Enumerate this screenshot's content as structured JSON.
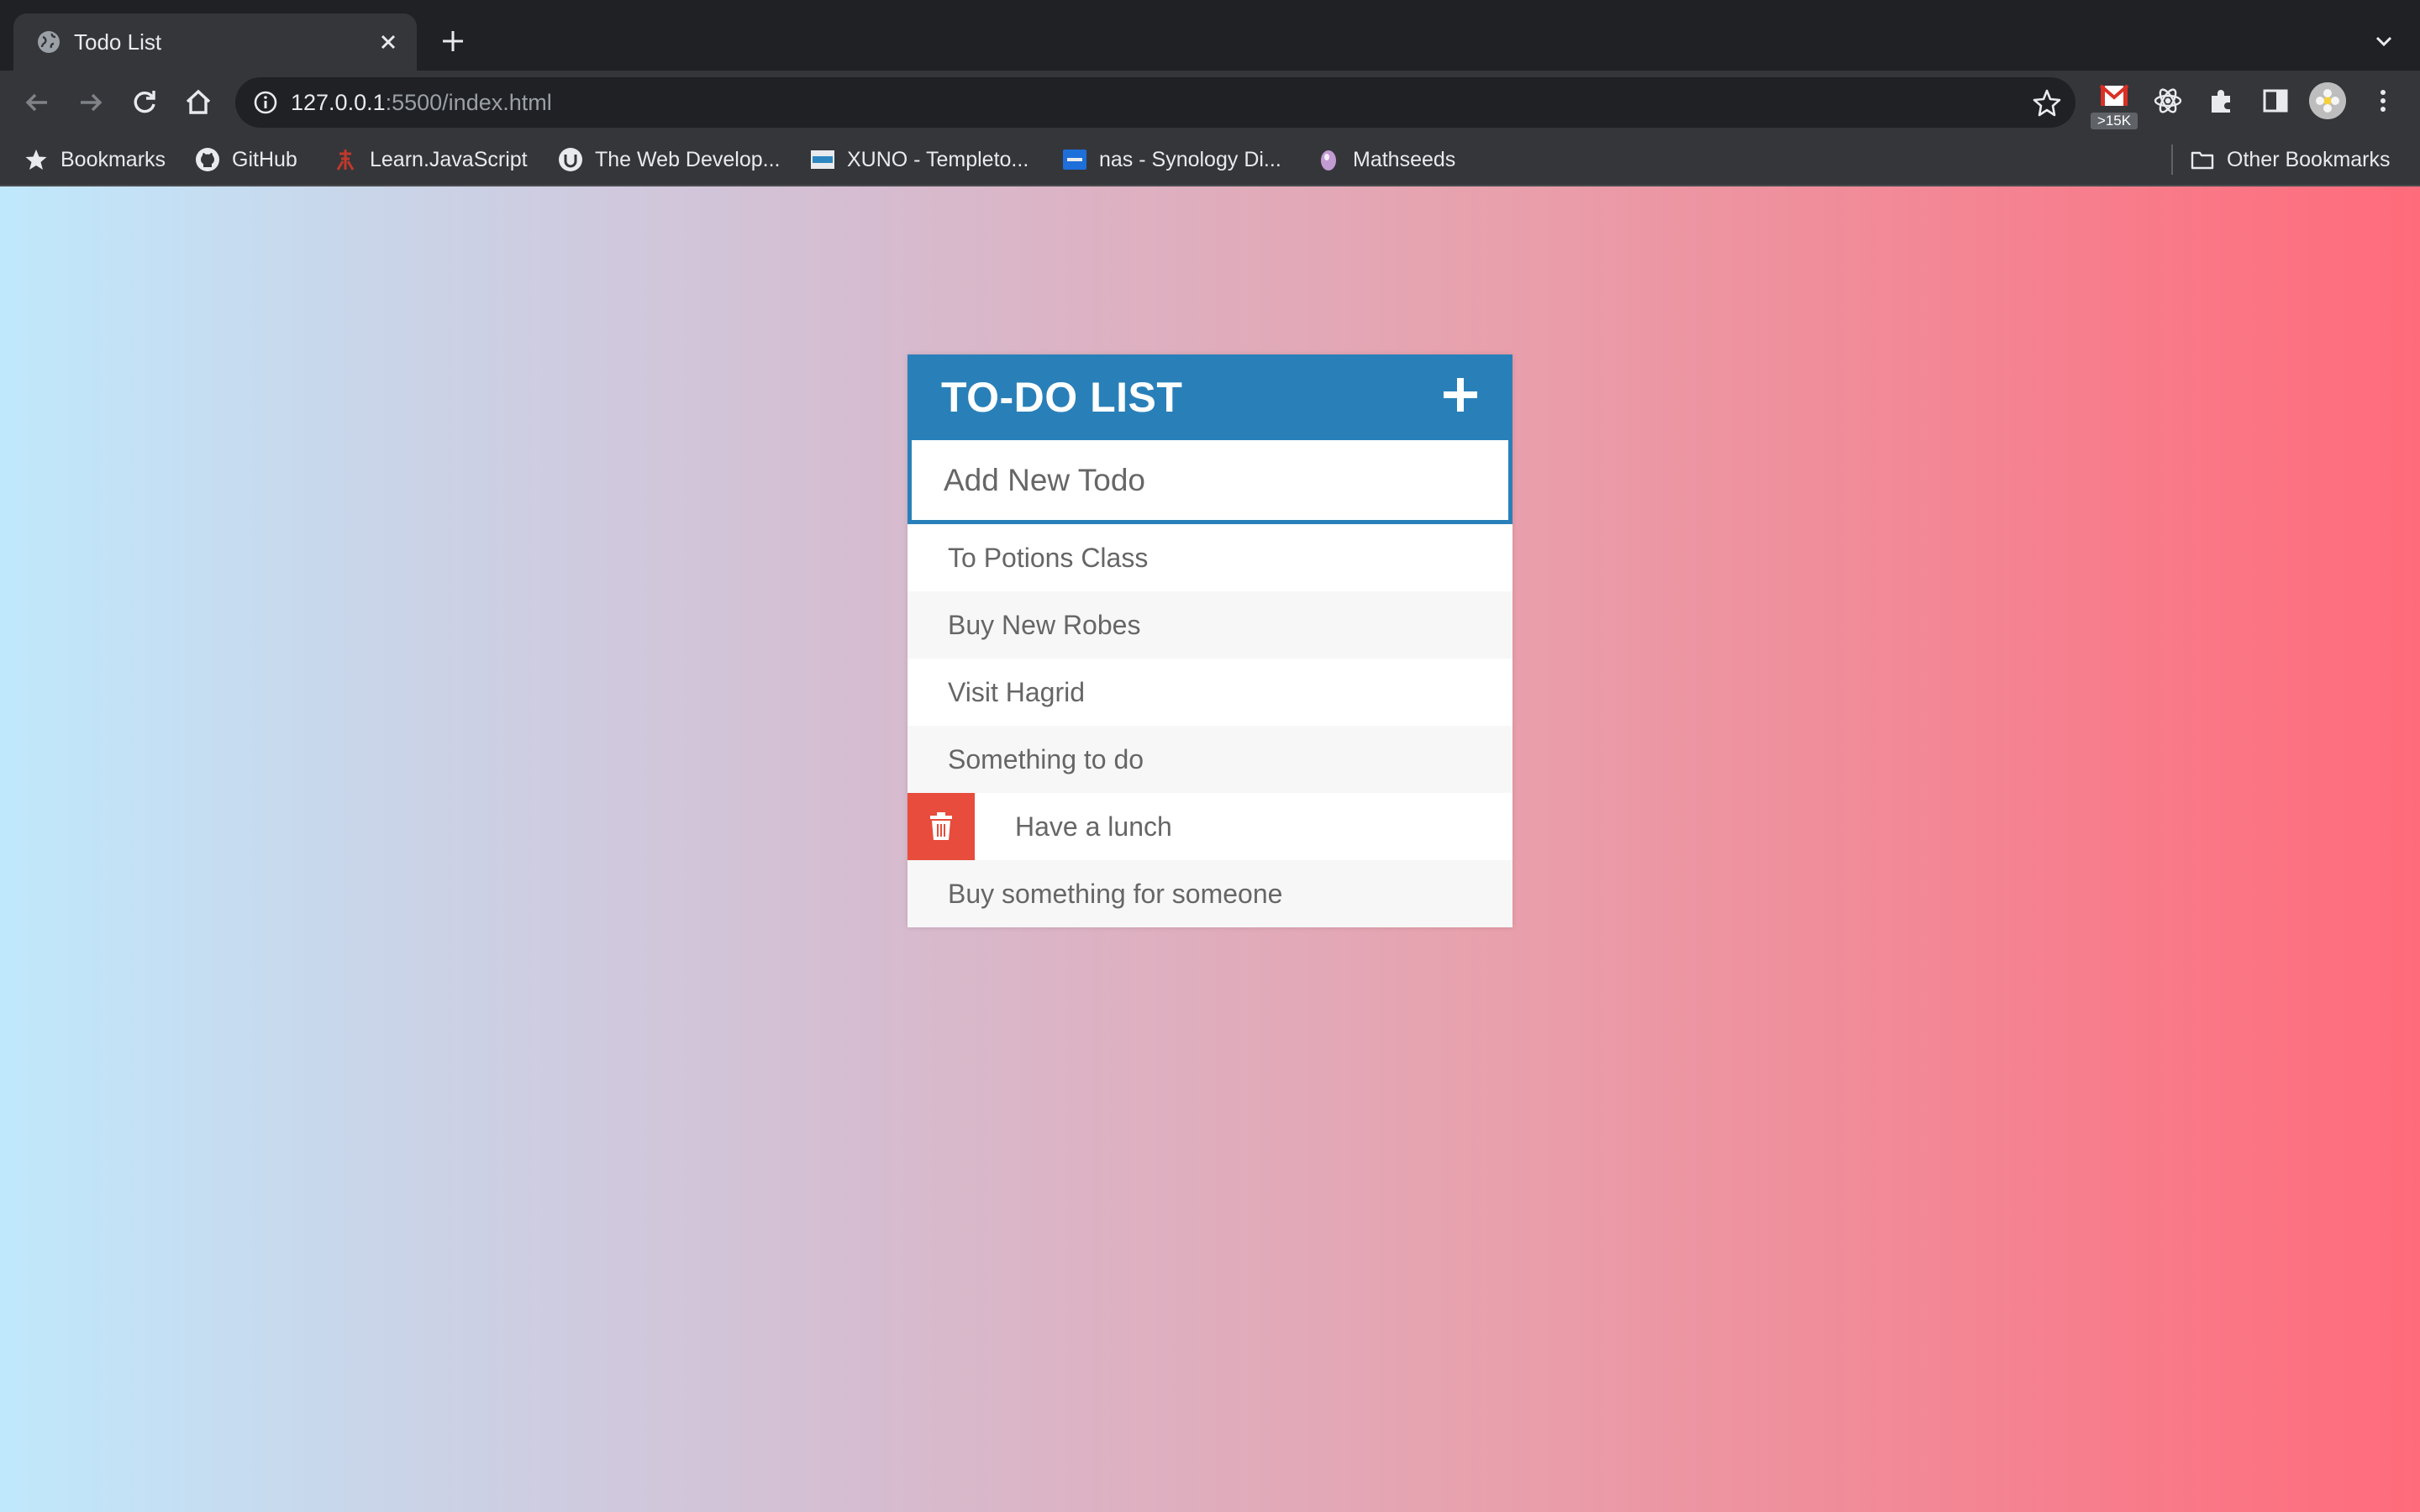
{
  "browser": {
    "tab_title": "Todo List",
    "url_host": "127.0.0.1",
    "url_rest": ":5500/index.html",
    "gmail_count": ">15K",
    "bookmarks": [
      {
        "label": "Bookmarks",
        "icon": "star-icon"
      },
      {
        "label": "GitHub",
        "icon": "github-icon"
      },
      {
        "label": "Learn.JavaScript",
        "icon": "learnjs-icon"
      },
      {
        "label": "The Web Develop...",
        "icon": "webdev-icon"
      },
      {
        "label": "XUNO - Templeto...",
        "icon": "xuno-icon"
      },
      {
        "label": "nas - Synology Di...",
        "icon": "synology-icon"
      },
      {
        "label": "Mathseeds",
        "icon": "mathseeds-icon"
      }
    ],
    "other_bookmarks": "Other Bookmarks"
  },
  "todo": {
    "title": "TO-DO LIST",
    "input_placeholder": "Add New Todo",
    "items": [
      {
        "text": "To Potions Class"
      },
      {
        "text": "Buy New Robes"
      },
      {
        "text": "Visit Hagrid"
      },
      {
        "text": "Something to do"
      },
      {
        "text": "Have a lunch",
        "hovered": true
      },
      {
        "text": "Buy something for someone"
      }
    ]
  },
  "colors": {
    "header": "#2980b9",
    "delete": "#e74c3c",
    "gradient_start": "#c0e8fc",
    "gradient_end": "#ff6b7b"
  }
}
